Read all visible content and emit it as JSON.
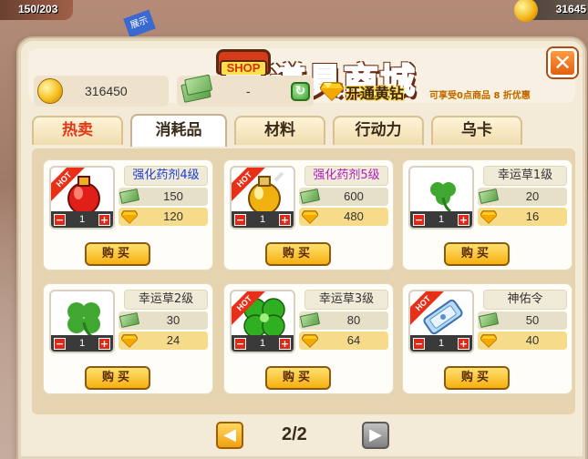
{
  "hud": {
    "hp_text": "150/203",
    "top_gold": "31645",
    "event_tag": "展示"
  },
  "shop": {
    "title": "道具商城",
    "sign": "SHOP",
    "close_label": "✕"
  },
  "currency": {
    "gold": "316450",
    "voucher": "-",
    "refresh_label": "↻"
  },
  "vip": {
    "title": "开通黄钻",
    "description": "可享受0点商品 8 折优惠"
  },
  "tabs": [
    {
      "label": "热卖",
      "hot": true
    },
    {
      "label": "消耗品",
      "active": true
    },
    {
      "label": "材料"
    },
    {
      "label": "行动力"
    },
    {
      "label": "乌卡"
    }
  ],
  "items": [
    {
      "name": "强化药剂4级",
      "name_color": "blue",
      "hot": true,
      "icon": "red-potion-icon",
      "qty": "1",
      "cash_price": "150",
      "gem_price": "120",
      "buy_label": "购买"
    },
    {
      "name": "强化药剂5级",
      "name_color": "purple",
      "hot": true,
      "icon": "gold-potion-icon",
      "qty": "1",
      "cash_price": "600",
      "gem_price": "480",
      "buy_label": "购买"
    },
    {
      "name": "幸运草1级",
      "name_color": "black",
      "hot": false,
      "icon": "small-clover-icon",
      "qty": "1",
      "cash_price": "20",
      "gem_price": "16",
      "buy_label": "购买"
    },
    {
      "name": "幸运草2级",
      "name_color": "black",
      "hot": false,
      "icon": "clover-icon",
      "qty": "1",
      "cash_price": "30",
      "gem_price": "24",
      "buy_label": "购买"
    },
    {
      "name": "幸运草3级",
      "name_color": "black",
      "hot": true,
      "icon": "big-clover-icon",
      "qty": "1",
      "cash_price": "80",
      "gem_price": "64",
      "buy_label": "购买"
    },
    {
      "name": "神佑令",
      "name_color": "black",
      "hot": true,
      "icon": "blessing-token-icon",
      "qty": "1",
      "cash_price": "50",
      "gem_price": "40",
      "buy_label": "购买"
    }
  ],
  "hot_label": "HOT",
  "pager": {
    "text": "2/2",
    "prev_label": "◀",
    "next_label": "▶"
  },
  "colors": {
    "hot_red": "#e83018",
    "buy_yellow": "#f5b010",
    "panel_bg": "#f4ead8"
  }
}
